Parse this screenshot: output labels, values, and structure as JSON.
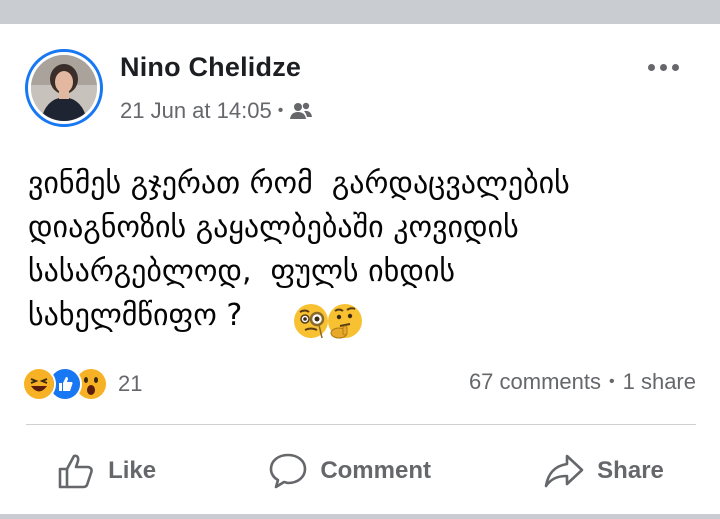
{
  "post": {
    "author": "Nino Chelidze",
    "timestamp": "21 Jun at 14:05",
    "separator": "•",
    "audience_icon": "friends-icon",
    "text": "ვინმეს გჯერათ რომ  გარდაცვალების\nდიაგნოზის გაყალბებაში კოვიდის\nსასარგებლოდ,  ფულს იხდის\nსახელმწიფო ?",
    "inline_emojis": [
      "face-with-monocle",
      "thinking-face"
    ]
  },
  "reactions": {
    "icons": [
      "haha",
      "like",
      "wow"
    ],
    "count": "21"
  },
  "stats": {
    "comments": "67 comments",
    "dot": "•",
    "shares": "1 share"
  },
  "actions": {
    "like": "Like",
    "comment": "Comment",
    "share": "Share"
  },
  "colors": {
    "brand_blue": "#1877f2",
    "text_secondary": "#65676b",
    "background": "#c9ccd1"
  }
}
